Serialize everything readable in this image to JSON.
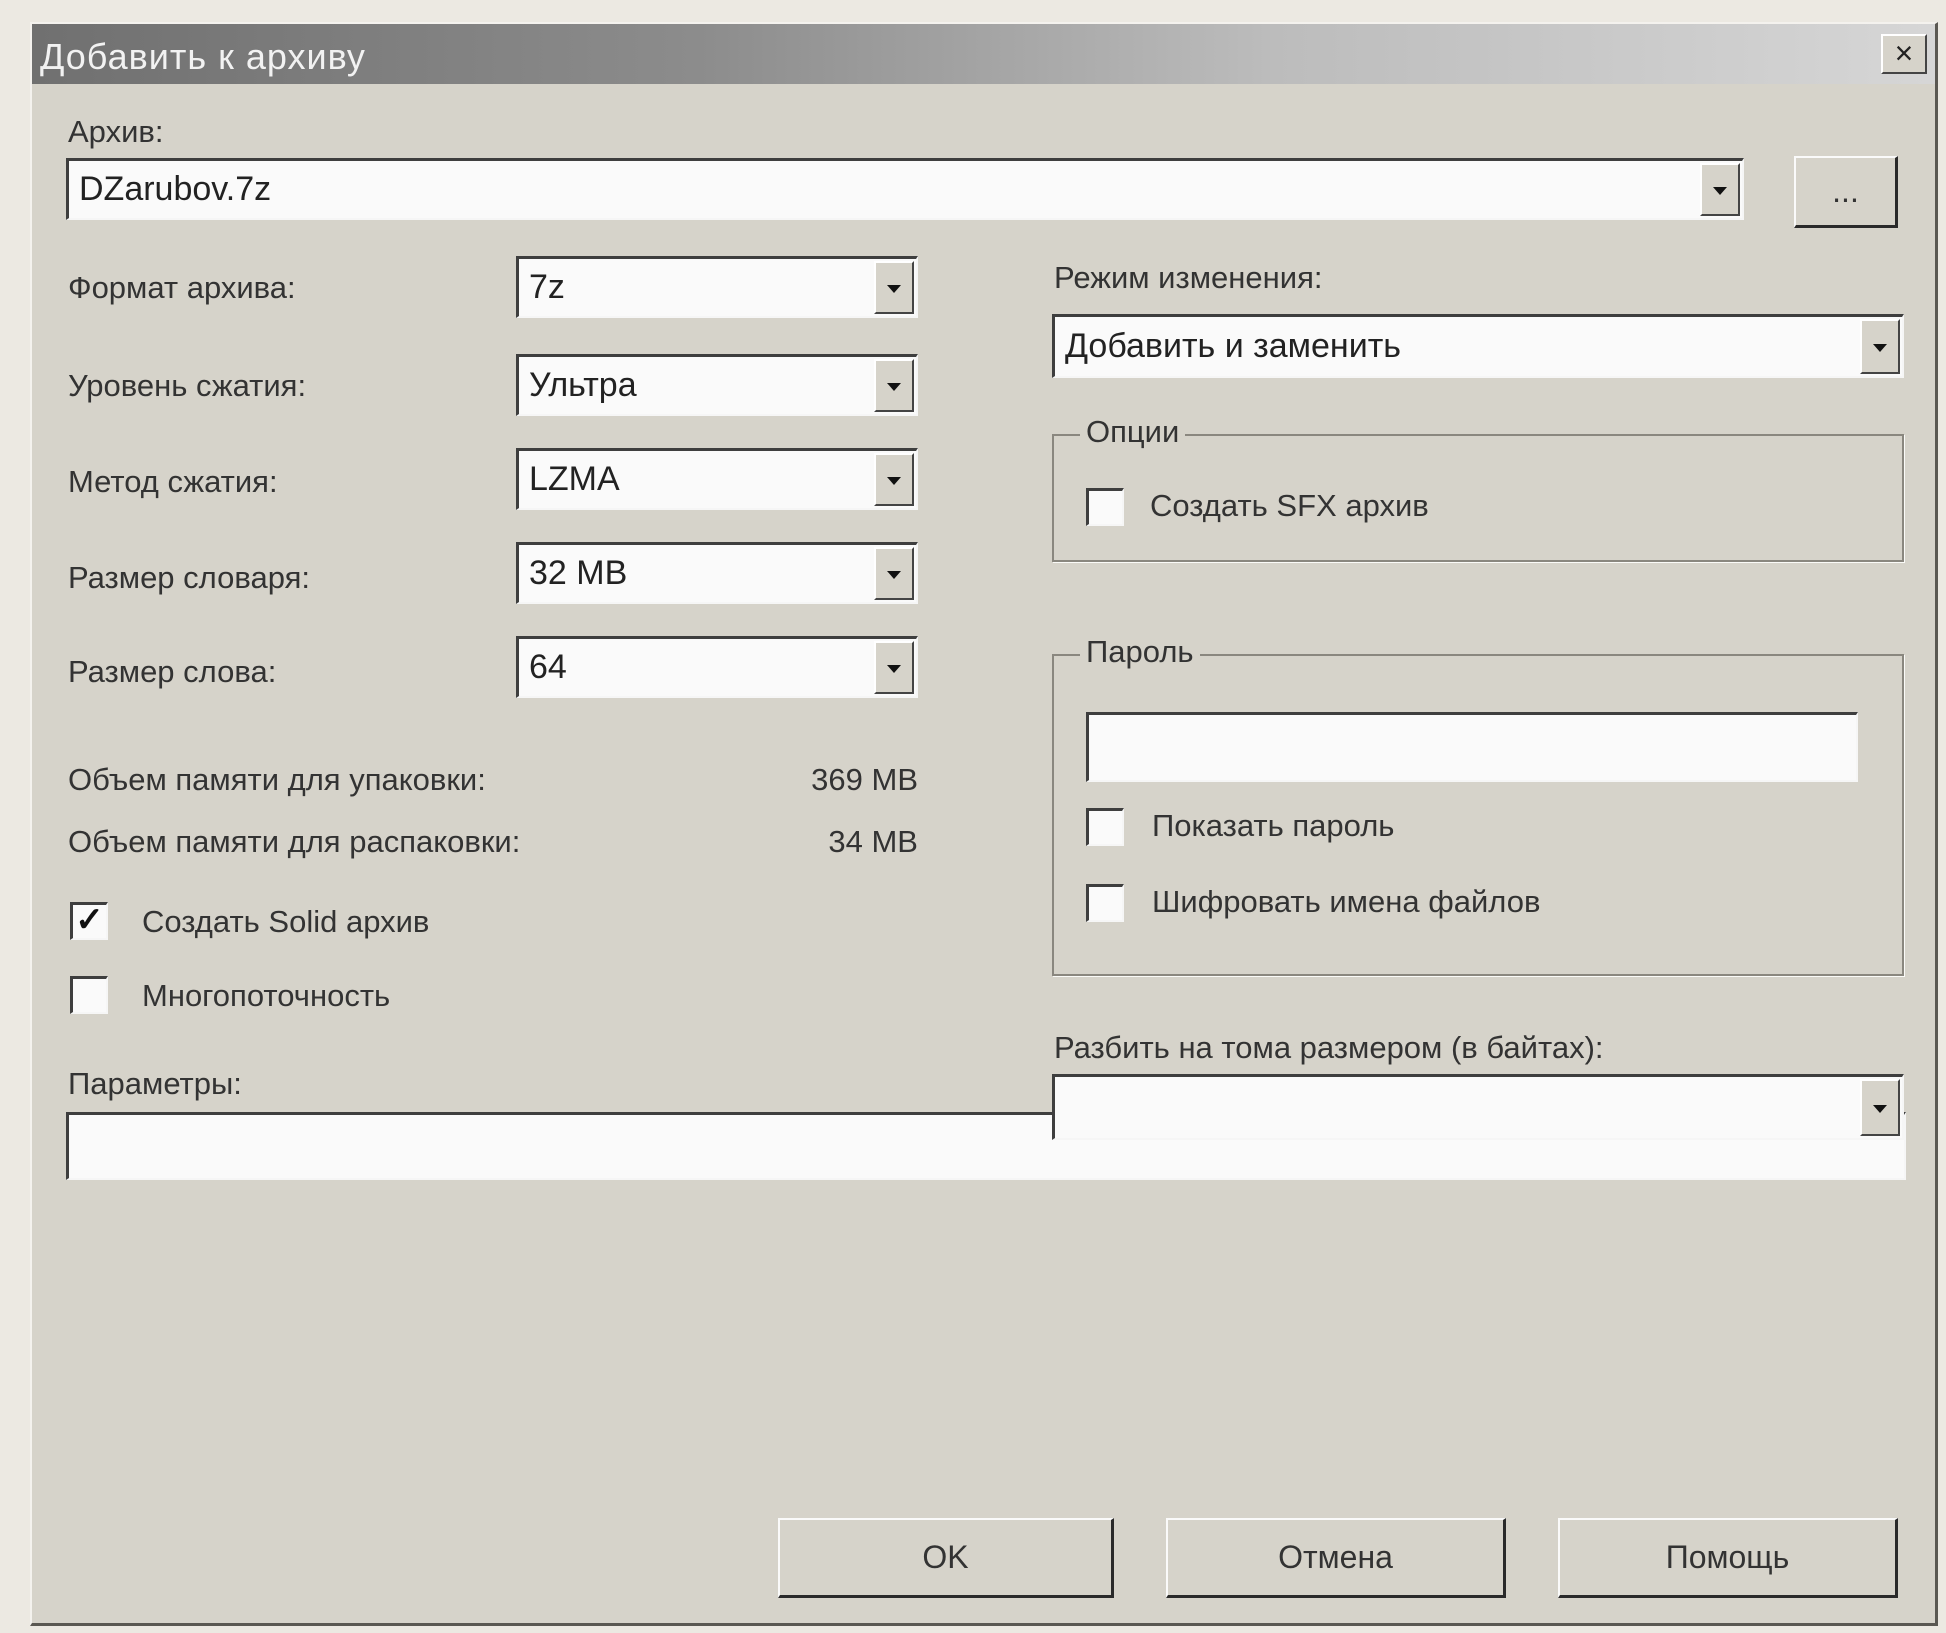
{
  "window": {
    "title": "Добавить к архиву",
    "close_label": "×"
  },
  "archive": {
    "label": "Архив:",
    "value": "DZarubov.7z",
    "browse_label": "..."
  },
  "format": {
    "label": "Формат архива:",
    "value": "7z"
  },
  "level": {
    "label": "Уровень сжатия:",
    "value": "Ультра"
  },
  "method": {
    "label": "Метод сжатия:",
    "value": "LZMA"
  },
  "dict": {
    "label": "Размер словаря:",
    "value": "32 MB"
  },
  "word": {
    "label": "Размер слова:",
    "value": "64"
  },
  "memory": {
    "pack_label": "Объем памяти для упаковки:",
    "pack_value": "369 MB",
    "unpack_label": "Объем памяти для распаковки:",
    "unpack_value": "34 MB"
  },
  "solid": {
    "label": "Создать Solid архив",
    "checked": true,
    "mark": "✓"
  },
  "multithread": {
    "label": "Многопоточность",
    "checked": false
  },
  "params": {
    "label": "Параметры:",
    "value": ""
  },
  "update_mode": {
    "label": "Режим изменения:",
    "value": "Добавить и заменить"
  },
  "options": {
    "legend": "Опции",
    "sfx_label": "Создать SFX архив",
    "sfx_checked": false
  },
  "password": {
    "legend": "Пароль",
    "value": "",
    "show_label": "Показать пароль",
    "encrypt_label": "Шифровать имена файлов"
  },
  "split": {
    "label": "Разбить на тома размером (в байтах):",
    "value": ""
  },
  "buttons": {
    "ok": "OK",
    "cancel": "Отмена",
    "help": "Помощь"
  }
}
